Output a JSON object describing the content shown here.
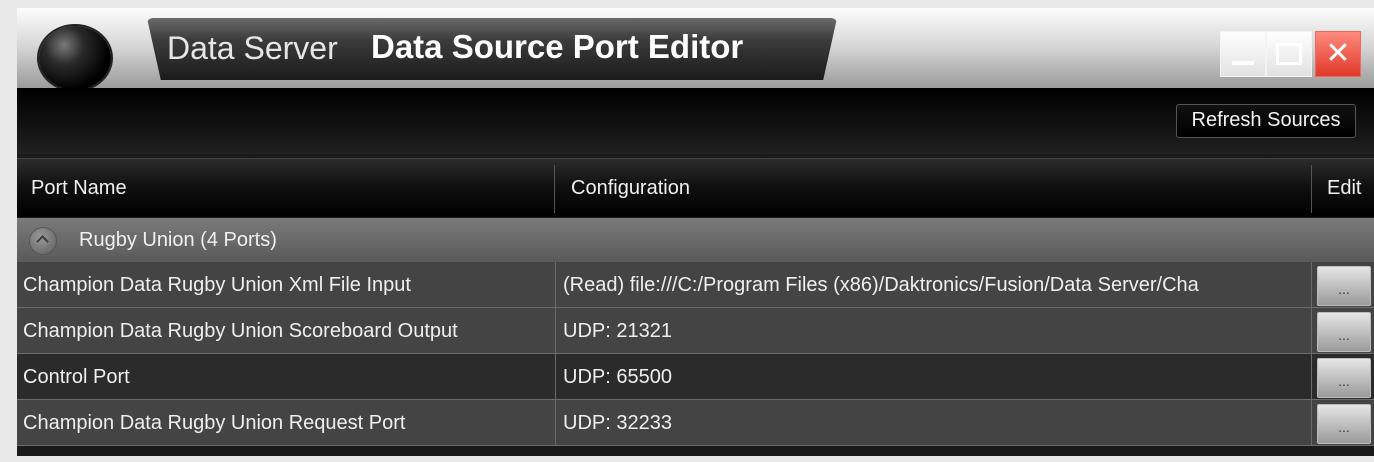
{
  "window": {
    "app_name": "Data Server",
    "title": "Data Source Port Editor",
    "close_glyph": "✕"
  },
  "toolbar": {
    "refresh_label": "Refresh Sources"
  },
  "table": {
    "columns": [
      "Port Name",
      "Configuration",
      "Edit"
    ],
    "group": {
      "label": "Rugby Union  (4 Ports)"
    },
    "rows": [
      {
        "port_name": "Champion Data Rugby Union Xml File Input",
        "configuration": "(Read) file:///C:/Program Files (x86)/Daktronics/Fusion/Data Server/Cha",
        "edit_label": "..."
      },
      {
        "port_name": "Champion Data Rugby Union Scoreboard Output",
        "configuration": "UDP: 21321",
        "edit_label": "..."
      },
      {
        "port_name": "Control Port",
        "configuration": "UDP: 65500",
        "edit_label": "..."
      },
      {
        "port_name": "Champion Data Rugby Union Request Port",
        "configuration": "UDP: 32233",
        "edit_label": "..."
      }
    ]
  },
  "icons": [
    "app-orb-icon",
    "minimize-icon",
    "maximize-icon",
    "close-icon",
    "collapse-chevron-icon"
  ]
}
